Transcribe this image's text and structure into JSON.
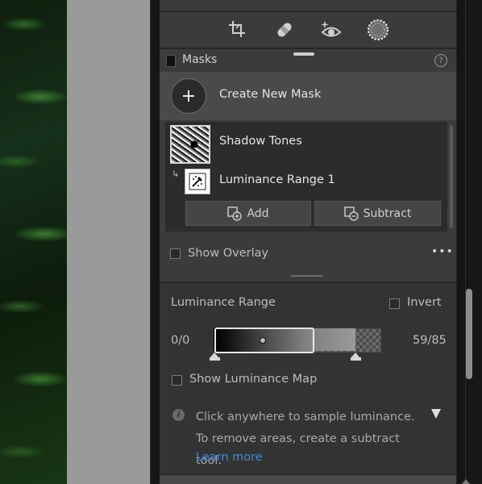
{
  "toolbar": {
    "tools": [
      "crop-icon",
      "healing-icon",
      "red-eye-icon",
      "masking-icon"
    ],
    "active_tool": "masking-icon"
  },
  "masks": {
    "title": "Masks",
    "help": "?",
    "create_label": "Create New Mask",
    "items": [
      {
        "label": "Shadow Tones",
        "type": "mask"
      },
      {
        "label": "Luminance Range 1",
        "type": "component"
      }
    ],
    "add_label": "Add",
    "subtract_label": "Subtract",
    "overlay_label": "Show Overlay",
    "overlay_checked": false,
    "more": "•••"
  },
  "luminance": {
    "title": "Luminance Range",
    "invert_label": "Invert",
    "invert_checked": false,
    "range_min_label": "0/0",
    "range_max_label": "59/85",
    "show_map_label": "Show Luminance Map",
    "show_map_checked": false,
    "info_icon": "i",
    "info_text": "Click anywhere to sample luminance. To remove areas, create a subtract tool.",
    "learn_more": "Learn more"
  },
  "colors": {
    "panel_bg": "#3b3b3b",
    "accent_link": "#3f8ad2"
  }
}
